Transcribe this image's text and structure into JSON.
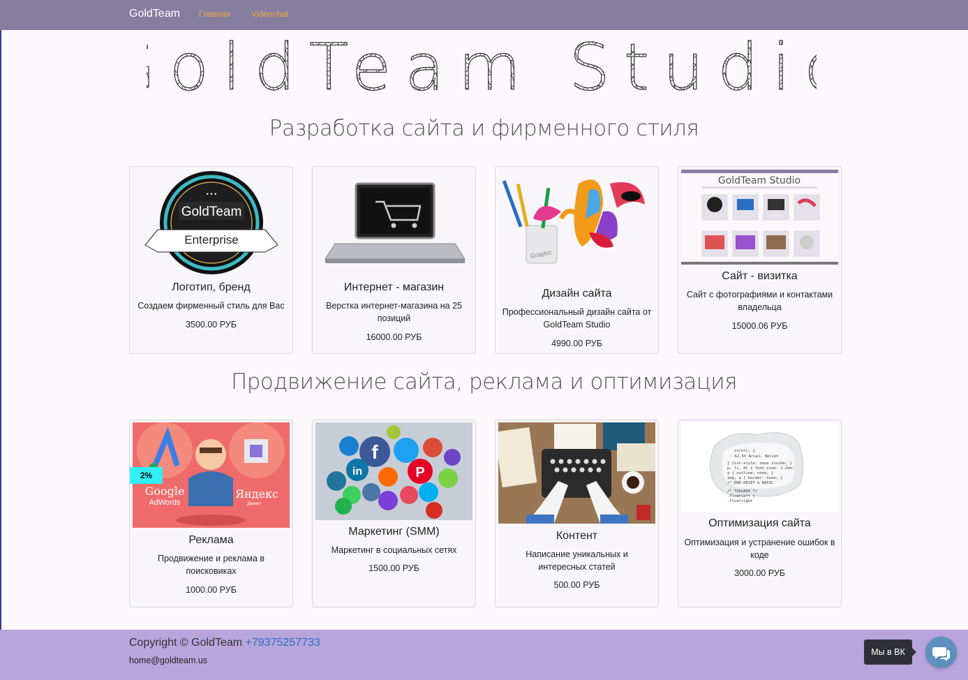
{
  "nav": {
    "brand": "GoldTeam",
    "links": [
      "Главная",
      "Videochat"
    ]
  },
  "hero": {
    "logo_text": "GoldTeam Studio"
  },
  "sections": [
    {
      "title": "Разработка сайта и фирменного стиля",
      "cards": [
        {
          "title": "Логотип, бренд",
          "desc": "Создаем фирменный стиль для Вас",
          "price": "3500.00 РУБ",
          "badge_top": "GoldTeam",
          "badge_bottom": "Enterprise"
        },
        {
          "title": "Интернет - магазин",
          "desc": "Верстка интернет-магазина на 25 позиций",
          "price": "16000.00 РУБ"
        },
        {
          "title": "Дизайн сайта",
          "desc": "Профессиональный дизайн сайта от GoldTeam Studio",
          "price": "4990.00 РУБ",
          "img_label": "Graphic"
        },
        {
          "title": "Сайт - визитка",
          "desc": "Сайт с фотографиями и контактами владельца",
          "price": "15000.06 РУБ",
          "thumb_title": "GoldTeam Studio"
        }
      ]
    },
    {
      "title": "Продвижение сайта, реклама и оптимизация",
      "cards": [
        {
          "title": "Реклама",
          "desc": "Продвижение и реклама в поисковиках",
          "price": "1000.00 РУБ",
          "discount": "2%",
          "img_left": "Google",
          "img_left_sub": "AdWords",
          "img_right": "Яндекс",
          "img_right_sub": "Директ"
        },
        {
          "title": "Маркетинг (SMM)",
          "desc": "Маркетинг в социальных сетях",
          "price": "1500.00 РУБ"
        },
        {
          "title": "Контент",
          "desc": "Написание уникальных и интересных статей",
          "price": "500.00 РУБ"
        },
        {
          "title": "Оптимизация сайта",
          "desc": "Оптимизация и устранение ошибок в коде",
          "price": "3000.00 РУБ"
        }
      ]
    }
  ],
  "footer": {
    "copyright": "Copyright © GoldTeam",
    "phone": "+79375257733",
    "email": "home@goldteam.us"
  },
  "widget": {
    "label": "Мы в ВК"
  },
  "colors": {
    "navbar": "#867e9f",
    "nav_link": "#f3a43a",
    "footer": "#b7a5dc",
    "phone_link": "#2a6fc0"
  }
}
